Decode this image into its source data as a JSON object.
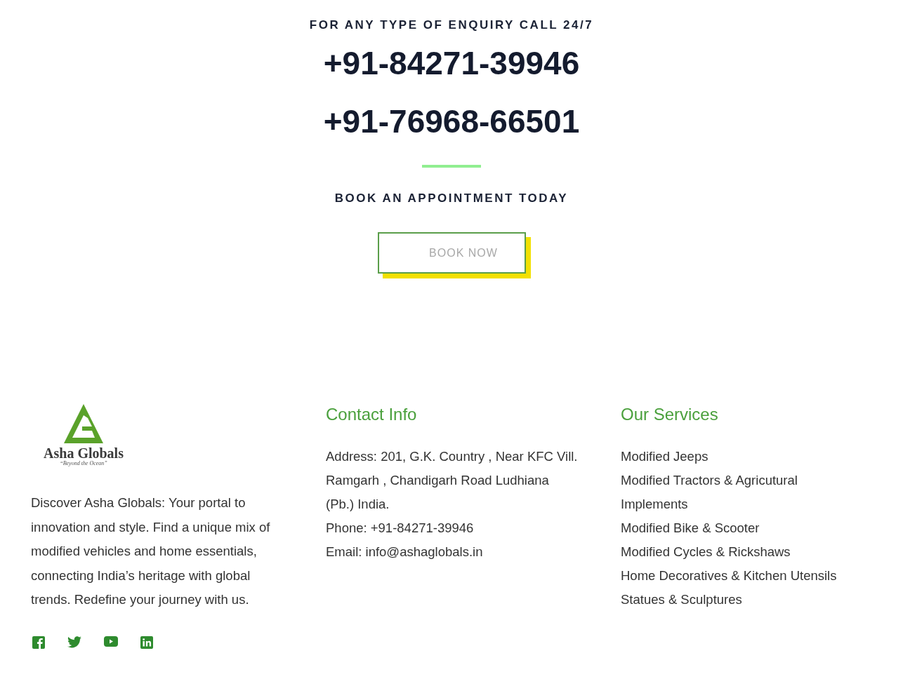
{
  "enquiry": {
    "heading": "FOR ANY TYPE OF ENQUIRY CALL 24/7",
    "phones": [
      "+91-84271-39946",
      "+91-76968-66501"
    ]
  },
  "appointment": {
    "heading": "BOOK AN APPOINTMENT TODAY",
    "button": "BOOK NOW"
  },
  "footer": {
    "logo": {
      "name": "Asha Globals",
      "tagline": "“Beyond the Ocean”"
    },
    "about": "Discover Asha Globals: Your portal to innovation and style. Find a unique mix of modified vehicles and home essentials, connecting India’s heritage with global trends. Redefine your journey with us.",
    "contact": {
      "title": "Contact Info",
      "lines": [
        "Address: 201, G.K. Country , Near KFC Vill. Ramgarh , Chandigarh Road Ludhiana (Pb.) India.",
        "Phone: +91-84271-39946",
        "Email: info@ashaglobals.in"
      ]
    },
    "services": {
      "title": "Our Services",
      "items": [
        "Modified Jeeps",
        "Modified Tractors & Agricutural Implements",
        "Modified Bike & Scooter",
        "Modified Cycles & Rickshaws",
        "Home Decoratives & Kitchen Utensils",
        "Statues & Sculptures"
      ]
    }
  }
}
